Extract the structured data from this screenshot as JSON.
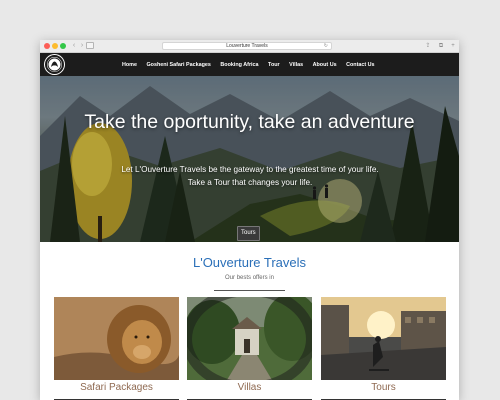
{
  "browser": {
    "tab_title": "Louverture Travels"
  },
  "nav": {
    "items": [
      "Home",
      "Gosheni Safari Packages",
      "Booking Africa",
      "Tour",
      "Villas",
      "About Us",
      "Contact Us"
    ]
  },
  "hero": {
    "title": "Take the oportunity, take an adventure",
    "subtitle": "Let L'Ouverture Travels be the gateway to the greatest time of your life. Take a Tour that changes your life.",
    "button": "Tours"
  },
  "about": {
    "title": "L'Ouverture Travels",
    "subtitle": "Our bests offers in"
  },
  "cards": [
    {
      "label": "Safari Packages"
    },
    {
      "label": "Villas"
    },
    {
      "label": "Tours"
    }
  ],
  "colors": {
    "nav_bg": "#1c1c1c",
    "accent_title": "#2a6fb8",
    "card_label": "#8f6a52"
  }
}
